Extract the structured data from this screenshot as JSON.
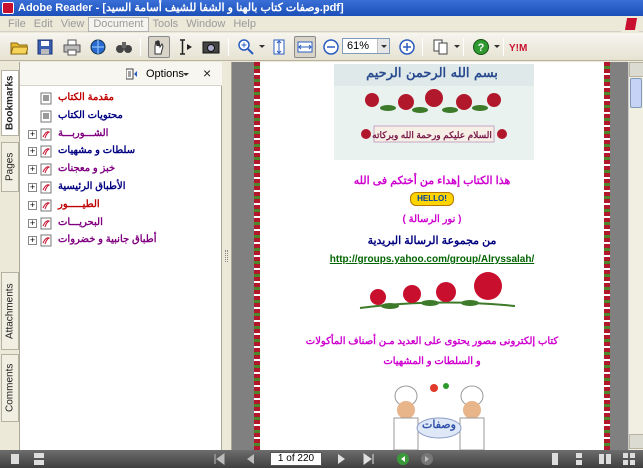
{
  "window": {
    "title": "Adobe Reader - [وصفات كتاب بالهنا و الشفا للشيف أسامة السيد.pdf]"
  },
  "menu": [
    "File",
    "Edit",
    "View",
    "Document",
    "Tools",
    "Window",
    "Help"
  ],
  "toolbar": {
    "zoom_value": "61%"
  },
  "side_tabs": [
    "Bookmarks",
    "Pages",
    "Attachments",
    "Comments"
  ],
  "nav_panel": {
    "options_label": "Options",
    "close_glyph": "×",
    "bookmarks": [
      {
        "label": "مقدمة الكتاب",
        "color": "#c00000",
        "expandable": false
      },
      {
        "label": "محتويات الكتاب",
        "color": "#000080",
        "expandable": false
      },
      {
        "label": "الشـــوربـــة",
        "color": "#800080",
        "expandable": true
      },
      {
        "label": "سلطات و مشهيات",
        "color": "#000080",
        "expandable": true
      },
      {
        "label": "خبز و معجنات",
        "color": "#800080",
        "expandable": true
      },
      {
        "label": "الأطباق الرئيسية",
        "color": "#000080",
        "expandable": true
      },
      {
        "label": "الطيـــــور",
        "color": "#c00000",
        "expandable": true
      },
      {
        "label": "البحريـــات",
        "color": "#800080",
        "expandable": true
      },
      {
        "label": "أطباق جانبية و خضروات",
        "color": "#800080",
        "expandable": true
      }
    ]
  },
  "page_content": {
    "header_script": "بسم الله الرحمن الرحيم",
    "greeting": "السلام عليكم ورحمة الله وبركاته",
    "dedication": "هذا الكتاب إهداء من أختكم فى الله",
    "hello_badge": "HELLO!",
    "author": "( نور الرسالة )",
    "group": "من مجموعة الرسالة البريدية",
    "url": "http://groups.yahoo.com/group/Alryssalah/",
    "desc_line1": "كتاب إلكترونى مصور يحتوى على العديد مـن أصناف المأكولات",
    "desc_line2": "و السلطات و المشهيات",
    "logo_text": "وصفات"
  },
  "statusbar": {
    "page_indicator": "1 of 220"
  },
  "colors": {
    "title_bar": "#1c4fb8",
    "rose": "#c8102e",
    "magenta_text": "#d000d0",
    "navy_text": "#00007f",
    "link_text": "#006400"
  }
}
